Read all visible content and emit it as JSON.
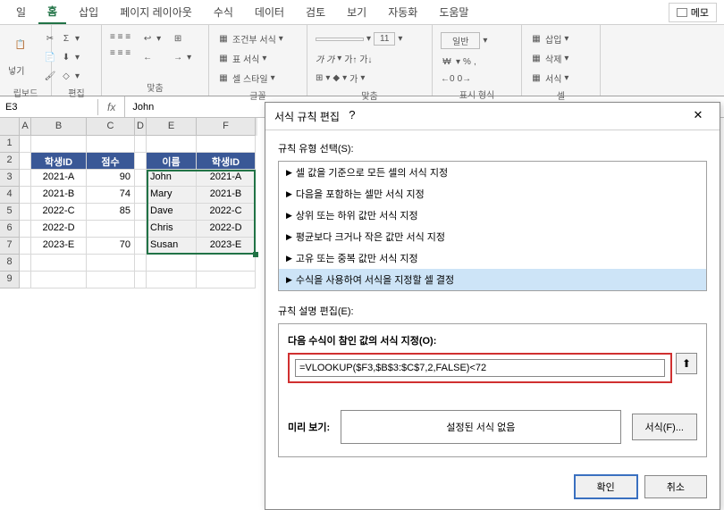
{
  "tabs": {
    "file": "일",
    "home": "홈",
    "insert": "삽입",
    "page_layout": "페이지 레이아웃",
    "formulas": "수식",
    "data": "데이터",
    "review": "검토",
    "view": "보기",
    "automate": "자동화",
    "help": "도움말"
  },
  "memo_button": "메모",
  "ribbon_groups": {
    "clipboard": "립보드",
    "font": "편집",
    "alignment": "맟춤",
    "styles": "글꼴",
    "number": "맟춤",
    "format": "표시 형식",
    "cells": "셀",
    "cond_format": "조건부 서식",
    "table_format": "표 서식",
    "cell_style": "셀 스타일",
    "general": "일반",
    "insert_btn": "삽입",
    "delete_btn": "삭제",
    "format_btn": "서식",
    "paste": "넣기"
  },
  "name_box": "E3",
  "fx_label": "fx",
  "formula_value": "John",
  "grid": {
    "headers_bc": {
      "b": "학생ID",
      "c": "점수"
    },
    "headers_ef": {
      "e": "이름",
      "f": "학생ID"
    },
    "rows_bc": [
      {
        "b": "2021-A",
        "c": "90"
      },
      {
        "b": "2021-B",
        "c": "74"
      },
      {
        "b": "2022-C",
        "c": "85"
      },
      {
        "b": "2022-D",
        "c": ""
      },
      {
        "b": "2023-E",
        "c": "70"
      }
    ],
    "rows_ef": [
      {
        "e": "John",
        "f": "2021-A"
      },
      {
        "e": "Mary",
        "f": "2021-B"
      },
      {
        "e": "Dave",
        "f": "2022-C"
      },
      {
        "e": "Chris",
        "f": "2022-D"
      },
      {
        "e": "Susan",
        "f": "2023-E"
      }
    ],
    "col_labels": [
      "A",
      "B",
      "C",
      "D",
      "E",
      "F"
    ],
    "row_labels": [
      "1",
      "2",
      "3",
      "4",
      "5",
      "6",
      "7",
      "8",
      "9"
    ]
  },
  "dialog": {
    "title": "서식 규칙 편집",
    "rule_type_label": "규칙 유형 선택(S):",
    "rule_types": [
      "셀 값을 기준으로 모든 셀의 서식 지정",
      "다음을 포함하는 셀만 서식 지정",
      "상위 또는 하위 값만 서식 지정",
      "평균보다 크거나 작은 값만 서식 지정",
      "고유 또는 중복 값만 서식 지정",
      "수식을 사용하여 서식을 지정할 셀 결정"
    ],
    "rule_desc_label": "규칙 설명 편집(E):",
    "formula_label": "다음 수식이 참인 값의 서식 지정(O):",
    "formula_value": "=VLOOKUP($F3,$B$3:$C$7,2,FALSE)<72",
    "preview_label": "미리 보기:",
    "preview_text": "설정된 서식 없음",
    "format_button": "서식(F)...",
    "ok_button": "확인",
    "cancel_button": "취소"
  }
}
